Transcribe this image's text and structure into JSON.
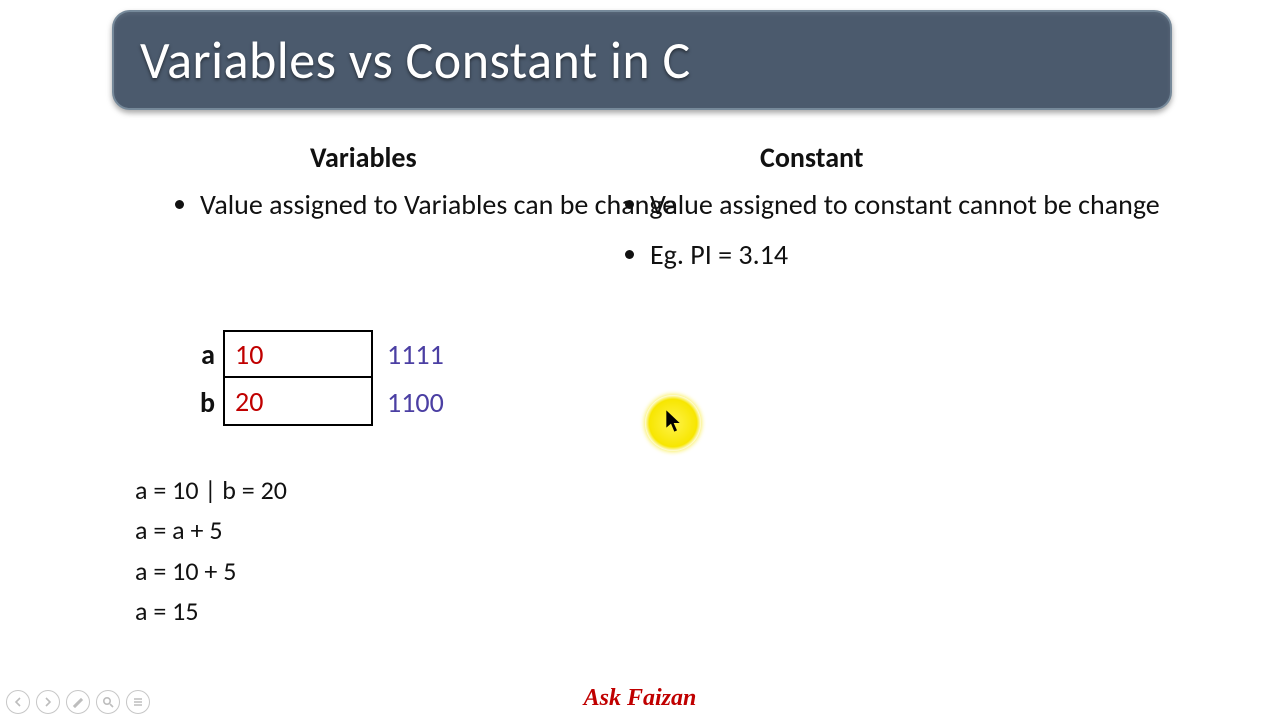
{
  "title": "Variables vs Constant in C",
  "left": {
    "heading": "Variables",
    "bullets": [
      "Value assigned to Variables can be change"
    ],
    "table": [
      {
        "label": "a",
        "value": "10",
        "addr": "1111"
      },
      {
        "label": "b",
        "value": "20",
        "addr": "1100"
      }
    ],
    "code": [
      "a = 10 | b = 20",
      "a = a + 5",
      "a = 10 + 5",
      "a = 15"
    ]
  },
  "right": {
    "heading": "Constant",
    "bullets": [
      "Value assigned to constant cannot be change",
      "Eg. PI = 3.14"
    ]
  },
  "footer": "Ask Faizan",
  "toolbar_icons": [
    "prev-icon",
    "next-icon",
    "pen-icon",
    "zoom-icon",
    "menu-icon"
  ]
}
